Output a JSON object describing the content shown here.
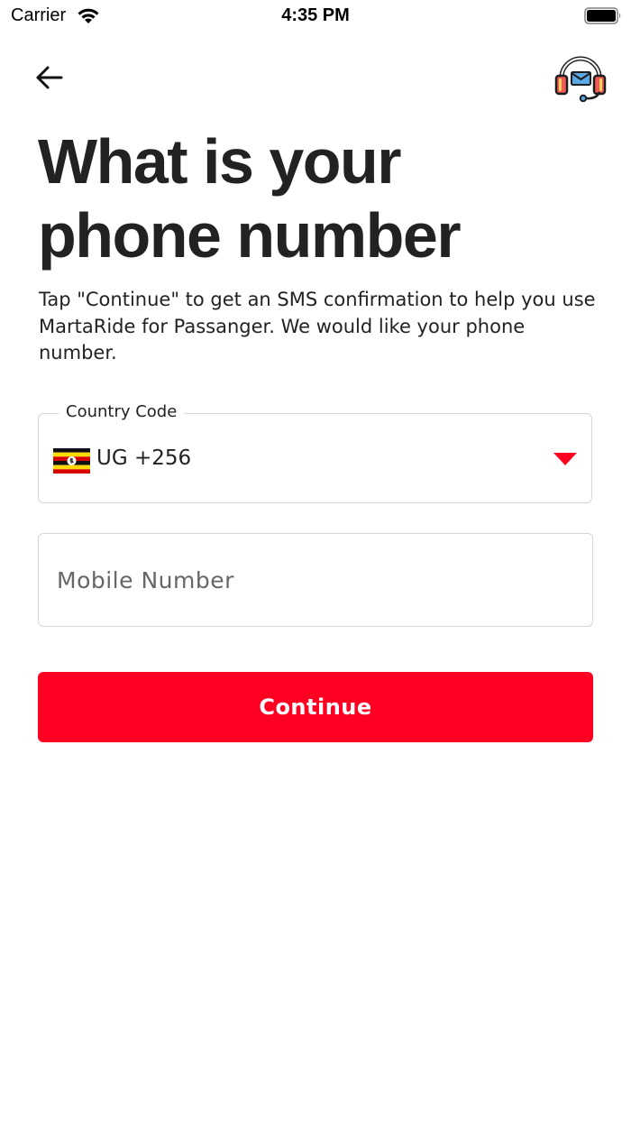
{
  "status_bar": {
    "carrier": "Carrier",
    "time": "4:35 PM"
  },
  "header": {
    "back_icon": "arrow-left-icon",
    "support_icon": "headset-mail-icon"
  },
  "page": {
    "title_line1": "What is your",
    "title_line2": "phone number",
    "description": "Tap \"Continue\" to get an SMS confirmation to help you use MartaRide for Passanger. We would like your phone number."
  },
  "form": {
    "country_code_label": "Country Code",
    "country_code_value": "UG +256",
    "flag_icon": "uganda-flag-icon",
    "mobile_placeholder": "Mobile Number",
    "mobile_value": ""
  },
  "actions": {
    "continue_label": "Continue"
  },
  "colors": {
    "accent": "#ff0023",
    "title": "#222222",
    "border": "#d6d6d6",
    "placeholder": "#666666"
  }
}
